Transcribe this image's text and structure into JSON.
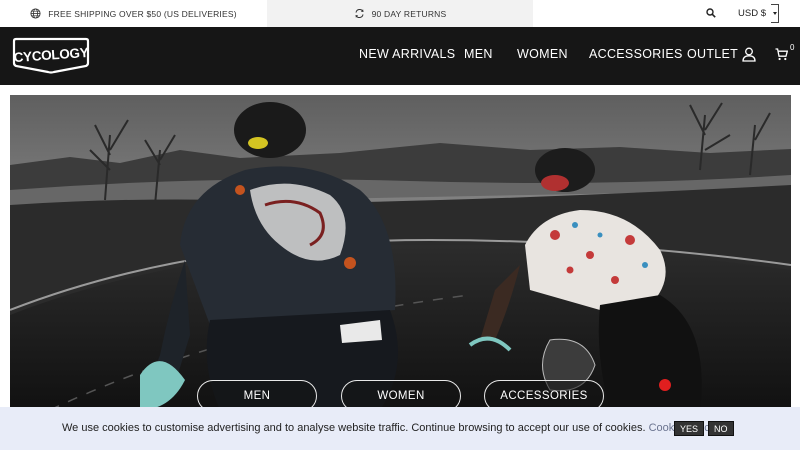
{
  "topbar": {
    "shipping_text": "FREE SHIPPING OVER $50 (US DELIVERIES)",
    "shipping_icon": "globe-icon",
    "returns_text": "90 DAY RETURNS",
    "returns_icon": "refresh-icon",
    "search_icon": "search-icon",
    "currency_label": "USD $"
  },
  "header": {
    "logo_text": "CYCOLOGY",
    "nav": [
      {
        "label": "NEW ARRIVALS"
      },
      {
        "label": "MEN"
      },
      {
        "label": "WOMEN"
      },
      {
        "label": "ACCESSORIES"
      },
      {
        "label": "OUTLET"
      }
    ],
    "account_icon": "user-icon",
    "cart_icon": "cart-icon",
    "cart_count": "0"
  },
  "hero": {
    "image_icon": "cyclists-photo",
    "buttons": [
      {
        "label": "MEN"
      },
      {
        "label": "WOMEN"
      },
      {
        "label": "ACCESSORIES"
      }
    ]
  },
  "cookie": {
    "message": "We use cookies to customise advertising and to analyse website traffic. Continue browsing to accept our use of cookies.",
    "link_label": "Cookie Policy.",
    "yes_label": "YES",
    "no_label": "NO"
  }
}
